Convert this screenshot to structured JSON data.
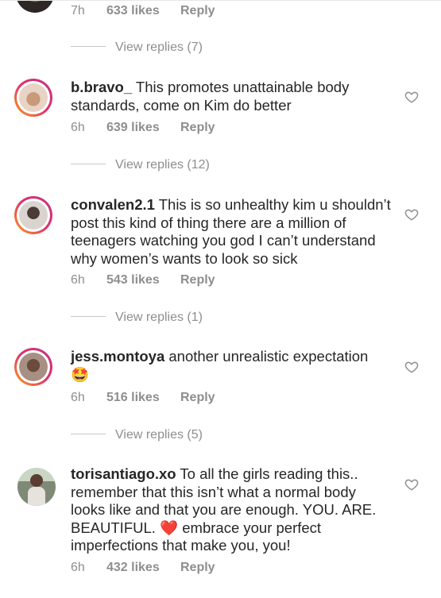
{
  "top_comment": {
    "time": "7h",
    "likes": "633 likes",
    "reply": "Reply"
  },
  "view_replies": [
    "View replies (7)",
    "View replies (12)",
    "View replies (1)",
    "View replies (5)"
  ],
  "comments": [
    {
      "username": "b.bravo_",
      "text": "This promotes unattainable body standards, come on Kim do better",
      "time": "6h",
      "likes": "639 likes",
      "reply": "Reply"
    },
    {
      "username": "convalen2.1",
      "text": "This is so unhealthy kim u shouldn’t post this kind of thing there are a million of teenagers watching you god I can’t understand why women’s wants to look so sick",
      "time": "6h",
      "likes": "543 likes",
      "reply": "Reply"
    },
    {
      "username": "jess.montoya",
      "text": "another unrealistic expectation",
      "emoji": "🤩",
      "time": "6h",
      "likes": "516 likes",
      "reply": "Reply"
    },
    {
      "username": "torisantiago.xo",
      "text_before": "To all the girls reading this.. remember that this isn’t what a normal body looks like and that you are enough. YOU. ARE. BEAUTIFUL.",
      "emoji": "❤️",
      "text_after": "embrace your perfect imperfections that make you, you!",
      "time": "6h",
      "likes": "432 likes",
      "reply": "Reply"
    }
  ],
  "icons": {
    "like": "heart-outline-icon",
    "avatar": "user-avatar"
  },
  "colors": {
    "meta": "#8e8e8e",
    "text": "#262626",
    "story_ring": "#e1306c"
  }
}
